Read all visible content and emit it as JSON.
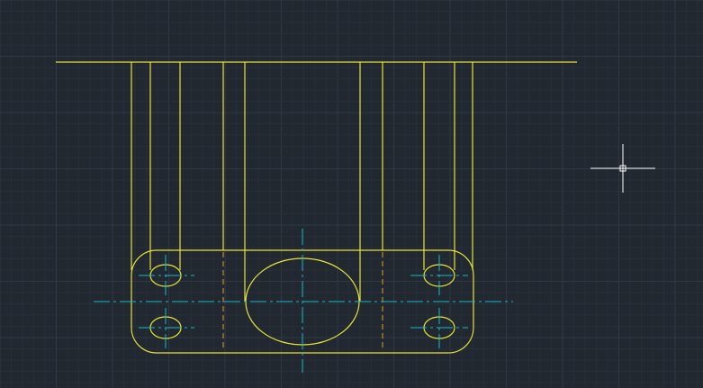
{
  "app": {
    "type": "cad-drawing-viewport"
  },
  "colors": {
    "background": "#212830",
    "grid_minor": "#262e38",
    "grid_major": "#2f3946",
    "geometry": "#e6e33a",
    "centerline": "#18b8c8",
    "hidden_line": "#e0a020",
    "crosshair": "#ffffff"
  },
  "icons": {
    "cursor": "crosshair-cursor-icon"
  },
  "drawing": {
    "layers": [
      "geometry",
      "centerline",
      "hidden"
    ],
    "description_visible_text": ""
  }
}
